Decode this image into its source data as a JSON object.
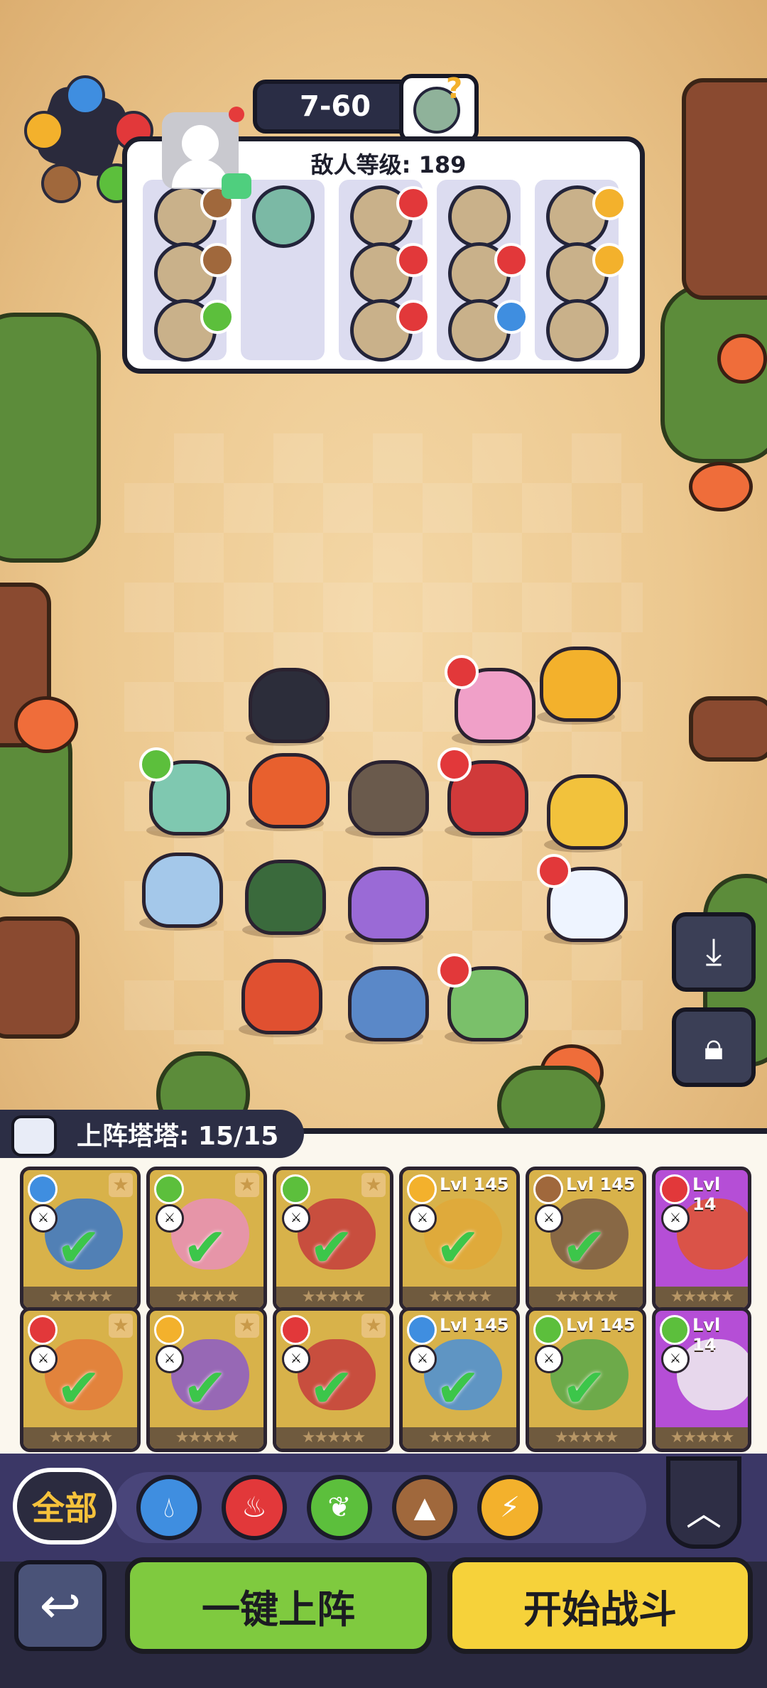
{
  "header": {
    "stage_label": "7-60",
    "enemy_level_label": "敌人等级: 189"
  },
  "enemy_lanes": [
    {
      "icons": [
        {
          "element": "earth"
        },
        {
          "element": "earth"
        },
        {
          "element": "grass"
        }
      ]
    },
    {
      "icons": []
    },
    {
      "icons": [
        {
          "element": "fire"
        },
        {
          "element": "fire"
        },
        {
          "element": "fire"
        }
      ]
    },
    {
      "icons": [
        {
          "element": "none"
        },
        {
          "element": "fire"
        },
        {
          "element": "water"
        }
      ]
    },
    {
      "icons": [
        {
          "element": "thunder"
        },
        {
          "element": "thunder"
        },
        {
          "element": "none"
        }
      ]
    }
  ],
  "roster": {
    "title": "上阵塔塔: 15/15",
    "cards": [
      {
        "element": "water",
        "level": "",
        "color": "#3a77c8"
      },
      {
        "element": "grass",
        "level": "",
        "color": "#e98fb8"
      },
      {
        "element": "grass",
        "level": "",
        "color": "#c63c3c"
      },
      {
        "element": "thunder",
        "level": "Lvl 145",
        "color": "#e0a838"
      },
      {
        "element": "earth",
        "level": "Lvl 145",
        "color": "#7a5a44"
      },
      {
        "element": "fire",
        "level": "Lvl 14",
        "color": "#e0552f"
      },
      {
        "element": "fire",
        "level": "",
        "color": "#e47a3a"
      },
      {
        "element": "thunder",
        "level": "",
        "color": "#8c5ac8"
      },
      {
        "element": "fire",
        "level": "",
        "color": "#c63c3c"
      },
      {
        "element": "water",
        "level": "Lvl 145",
        "color": "#4a8fd8"
      },
      {
        "element": "grass",
        "level": "Lvl 145",
        "color": "#5aa84a"
      },
      {
        "element": "grass",
        "level": "Lvl 14",
        "color": "#f0f0f0"
      }
    ],
    "star_text": "★★★★★"
  },
  "filters": {
    "all_label": "全部",
    "elements": [
      "water",
      "fire",
      "grass",
      "earth",
      "thunder"
    ]
  },
  "actions": {
    "auto_deploy_label": "一键上阵",
    "start_battle_label": "开始战斗"
  },
  "colors": {
    "water": "#3f8ee0",
    "fire": "#e2383a",
    "grass": "#5cbf3c",
    "earth": "#a0683c",
    "thunder": "#f3b12c",
    "none": "#9aa0a8"
  }
}
